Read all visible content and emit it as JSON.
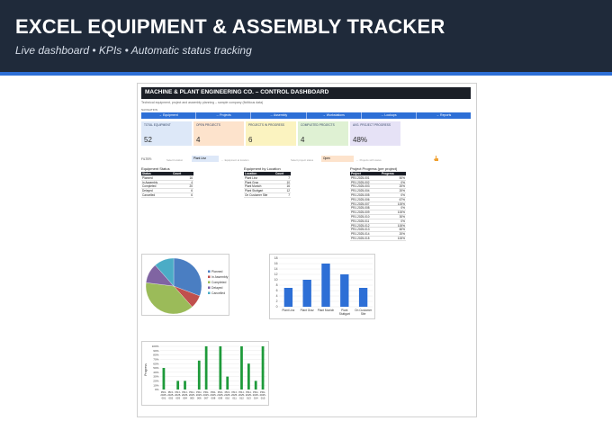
{
  "banner": {
    "title": "EXCEL EQUIPMENT & ASSEMBLY TRACKER",
    "subtitle": "Live dashboard  •  KPIs  •  Automatic status tracking",
    "accent_color": "#2d6fd6",
    "bg_color": "#1f2a3a"
  },
  "sheet": {
    "title": "MACHINE & PLANT ENGINEERING CO. – CONTROL DASHBOARD",
    "subtitle": "Technical equipment, project and assembly planning – sample company (fictitious data)",
    "nav_label": "NAVIGATION",
    "nav": [
      "→ Equipment",
      "→ Projects",
      "→ Assembly",
      "→ Workstations",
      "→ Lookups",
      "→ Reports"
    ],
    "kpis": [
      {
        "label": "TOTAL EQUIPMENT",
        "value": "52",
        "color": "#dde8f8"
      },
      {
        "label": "OPEN PROJECTS",
        "value": "4",
        "color": "#fde3cc"
      },
      {
        "label": "PROJECTS IN PROGRESS",
        "value": "6",
        "color": "#fbf3c0"
      },
      {
        "label": "COMPLETED PROJECTS",
        "value": "4",
        "color": "#dff1d3"
      },
      {
        "label": "AVG. PROJECT PROGRESS",
        "value": "48%",
        "color": "#e6e2f6"
      }
    ],
    "filter": {
      "label": "FILTER:",
      "location_hint": "Select location",
      "location_value": "Plant Linz",
      "location_note": "← Equipment at location",
      "project_hint": "Select project status",
      "project_value": "Open",
      "project_note": "← Projects with status"
    },
    "equipment_status": {
      "title": "Equipment Status",
      "headers": [
        "Status",
        "Count"
      ],
      "rows": [
        [
          "Planned",
          "16"
        ],
        [
          "In Assembly",
          "4"
        ],
        [
          "Completed",
          "20"
        ],
        [
          "Delayed",
          "6"
        ],
        [
          "Cancelled",
          "6"
        ]
      ]
    },
    "equipment_location": {
      "title": "Equipment by Location",
      "headers": [
        "Location",
        "Count"
      ],
      "rows": [
        [
          "Plant Linz",
          "7"
        ],
        [
          "Plant Graz",
          "10"
        ],
        [
          "Plant Munich",
          "16"
        ],
        [
          "Plant Stuttgart",
          "12"
        ],
        [
          "On Customer Site",
          "7"
        ]
      ]
    },
    "project_progress": {
      "title": "Project Progress (per project)",
      "headers": [
        "Project",
        "Progress"
      ],
      "rows": [
        [
          "PRJ-2025-001",
          "50%"
        ],
        [
          "PRJ-2025-002",
          "0%"
        ],
        [
          "PRJ-2025-003",
          "20%"
        ],
        [
          "PRJ-2025-004",
          "20%"
        ],
        [
          "PRJ-2025-005",
          "0%"
        ],
        [
          "PRJ-2025-006",
          "67%"
        ],
        [
          "PRJ-2025-007",
          "100%"
        ],
        [
          "PRJ-2025-008",
          "0%"
        ],
        [
          "PRJ-2025-009",
          "100%"
        ],
        [
          "PRJ-2025-010",
          "30%"
        ],
        [
          "PRJ-2025-011",
          "0%"
        ],
        [
          "PRJ-2025-012",
          "100%"
        ],
        [
          "PRJ-2025-013",
          "60%"
        ],
        [
          "PRJ-2025-014",
          "20%"
        ],
        [
          "PRJ-2025-015",
          "100%"
        ]
      ]
    }
  },
  "chart_data": [
    {
      "type": "pie",
      "series": [
        {
          "values": [
            16,
            4,
            20,
            6,
            6
          ]
        }
      ],
      "categories": [
        "Planned",
        "In Assembly",
        "Completed",
        "Delayed",
        "Cancelled"
      ],
      "colors": [
        "#4a7ec2",
        "#c0504d",
        "#9bbb59",
        "#8064a2",
        "#4bacc6"
      ],
      "legend": "right"
    },
    {
      "type": "bar",
      "categories": [
        "Plant Linz",
        "Plant Graz",
        "Plant Munich",
        "Plant Stuttgart",
        "On Customer Site"
      ],
      "values": [
        7,
        10,
        16,
        12,
        7
      ],
      "ylim": [
        0,
        18
      ],
      "yticks": [
        0,
        2,
        4,
        6,
        8,
        10,
        12,
        14,
        16,
        18
      ],
      "tick_labels": [
        "Plant Linz",
        "Plant Graz",
        "Plant Munich",
        "Plant Stuttgart",
        "On Customer Site"
      ],
      "color": "#2d6fd6",
      "grid": true
    },
    {
      "type": "bar",
      "categories": [
        "PRJ-2025-001",
        "PRJ-2025-002",
        "PRJ-2025-003",
        "PRJ-2025-004",
        "PRJ-2025-005",
        "PRJ-2025-006",
        "PRJ-2025-007",
        "PRJ-2025-008",
        "PRJ-2025-009",
        "PRJ-2025-010",
        "PRJ-2025-011",
        "PRJ-2025-012",
        "PRJ-2025-013",
        "PRJ-2025-014",
        "PRJ-2025-015"
      ],
      "values": [
        50,
        0,
        20,
        20,
        0,
        67,
        100,
        0,
        100,
        30,
        0,
        100,
        60,
        20,
        100
      ],
      "ylabel": "Progress",
      "ylim": [
        0,
        1
      ],
      "ytick_labels": [
        "0%",
        "10%",
        "20%",
        "30%",
        "40%",
        "50%",
        "60%",
        "70%",
        "80%",
        "90%",
        "100%"
      ],
      "color": "#1e9a3a",
      "grid": true
    }
  ]
}
